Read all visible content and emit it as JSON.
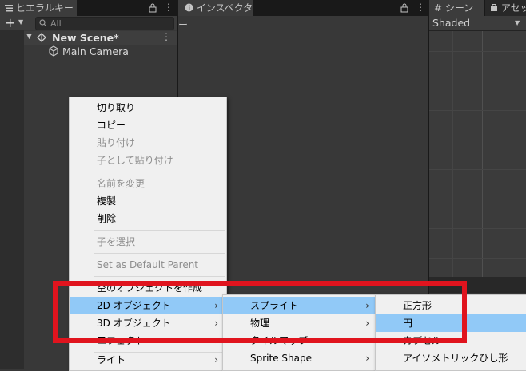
{
  "hierarchy": {
    "tab_title": "ヒエラルキー",
    "search_placeholder": "All",
    "scene_name": "New Scene*",
    "items": [
      {
        "label": "Main Camera"
      }
    ]
  },
  "inspector": {
    "tab_title": "インスペクター"
  },
  "scene": {
    "tab_title": "シーン",
    "asset_tab_title": "アセッ",
    "shading_mode": "Shaded"
  },
  "context_menu": {
    "items": [
      {
        "label": "切り取り"
      },
      {
        "label": "コピー"
      },
      {
        "label": "貼り付け"
      },
      {
        "label": "子として貼り付け"
      },
      {
        "label": "名前を変更"
      },
      {
        "label": "複製"
      },
      {
        "label": "削除"
      },
      {
        "label": "子を選択"
      },
      {
        "label": "Set as Default Parent"
      },
      {
        "label": "空のオブジェクトを作成"
      },
      {
        "label": "2D オブジェクト"
      },
      {
        "label": "3D オブジェクト"
      },
      {
        "label": "エフェクト"
      },
      {
        "label": "ライト"
      }
    ]
  },
  "submenu_2d": {
    "items": [
      {
        "label": "スプライト"
      },
      {
        "label": "物理"
      },
      {
        "label": "タイルマップ"
      },
      {
        "label": "Sprite Shape"
      }
    ]
  },
  "submenu_sprite": {
    "items": [
      {
        "label": "正方形"
      },
      {
        "label": "円"
      },
      {
        "label": "カプセル"
      },
      {
        "label": "アイソメトリックひし形"
      }
    ]
  },
  "colors": {
    "highlight": "#91c9f7",
    "annotation_red": "#e0141e",
    "menu_bg": "#f0f0f0",
    "editor_bg": "#383838"
  }
}
